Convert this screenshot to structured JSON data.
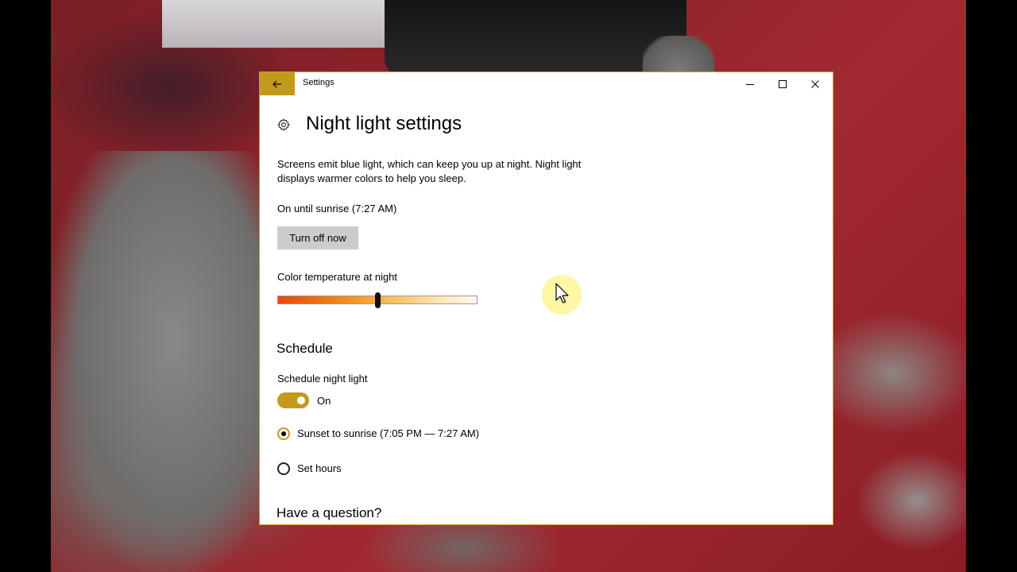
{
  "window": {
    "title": "Settings"
  },
  "page": {
    "title": "Night light settings",
    "description": "Screens emit blue light, which can keep you up at night. Night light displays warmer colors to help you sleep.",
    "status": "On until sunrise (7:27 AM)",
    "turn_off_label": "Turn off now"
  },
  "color_temperature": {
    "label": "Color temperature at night",
    "value_fraction": 0.5
  },
  "schedule": {
    "heading": "Schedule",
    "toggle_label": "Schedule night light",
    "toggle_state": "On",
    "toggle_on": true,
    "options": [
      {
        "label": "Sunset to sunrise (7:05 PM — 7:27 AM)",
        "selected": true
      },
      {
        "label": "Set hours",
        "selected": false
      }
    ]
  },
  "help": {
    "heading": "Have a question?"
  },
  "colors": {
    "accent": "#c49a1c",
    "button_bg": "#cccccc"
  },
  "icons": [
    "back-arrow-icon",
    "minimize-icon",
    "maximize-icon",
    "close-icon",
    "gear-icon",
    "mouse-pointer-icon"
  ]
}
